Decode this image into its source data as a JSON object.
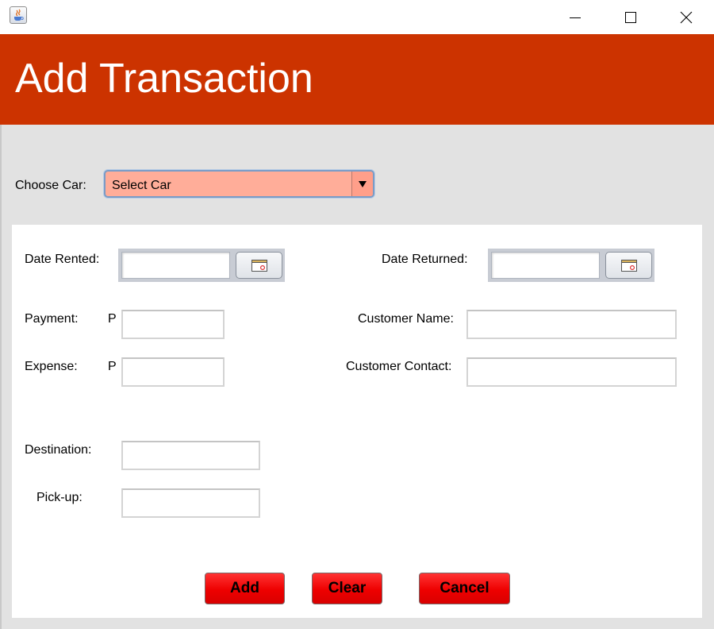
{
  "window": {
    "icon": "java-coffee-icon",
    "controls": [
      "minimize-icon",
      "maximize-icon",
      "close-icon"
    ]
  },
  "header": {
    "title": "Add Transaction",
    "background": "#cc3300"
  },
  "car": {
    "label": "Choose Car:",
    "selected": "Select Car",
    "background": "#ffad99"
  },
  "form": {
    "date_rented_label": "Date Rented:",
    "date_rented_value": "",
    "date_returned_label": "Date Returned:",
    "date_returned_value": "",
    "payment_label": "Payment:",
    "payment_currency": "P",
    "payment_value": "",
    "expense_label": "Expense:",
    "expense_currency": "P",
    "expense_value": "",
    "customer_name_label": "Customer Name:",
    "customer_name_value": "",
    "customer_contact_label": "Customer Contact:",
    "customer_contact_value": "",
    "destination_label": "Destination:",
    "destination_value": "",
    "pickup_label": "Pick-up:",
    "pickup_value": ""
  },
  "buttons": {
    "add": "Add",
    "clear": "Clear",
    "cancel": "Cancel",
    "color": "#ee0000"
  }
}
